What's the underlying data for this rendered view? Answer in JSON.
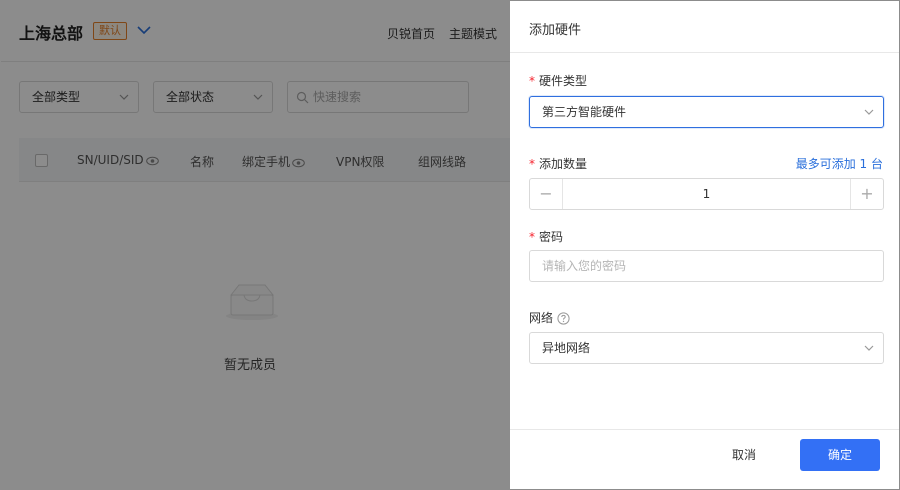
{
  "background": {
    "org_title": "上海总部",
    "default_badge": "默认",
    "nav": {
      "home": "贝锐首页",
      "theme": "主题模式"
    },
    "filters": {
      "type": "全部类型",
      "status": "全部状态"
    },
    "search": {
      "placeholder": "快速搜索"
    },
    "table": {
      "columns": [
        "SN/UID/SID",
        "名称",
        "绑定手机",
        "VPN权限",
        "组网线路"
      ]
    },
    "empty_text": "暂无成员"
  },
  "drawer": {
    "title": "添加硬件",
    "hardware_type": {
      "label": "硬件类型",
      "value": "第三方智能硬件"
    },
    "quantity": {
      "label": "添加数量",
      "limit_text": "最多可添加 1 台",
      "value": "1",
      "minus": "−",
      "plus": "+"
    },
    "password": {
      "label": "密码",
      "placeholder": "请输入您的密码"
    },
    "network": {
      "label": "网络",
      "value": "异地网络"
    },
    "footer": {
      "cancel": "取消",
      "confirm": "确定"
    }
  },
  "colors": {
    "primary": "#3370f5",
    "link": "#2a6fdb",
    "required": "#f5222d",
    "badge": "#e8822a"
  },
  "icons": [
    "chevron-down-icon",
    "search-icon",
    "eye-icon",
    "empty-box-icon",
    "help-icon"
  ]
}
